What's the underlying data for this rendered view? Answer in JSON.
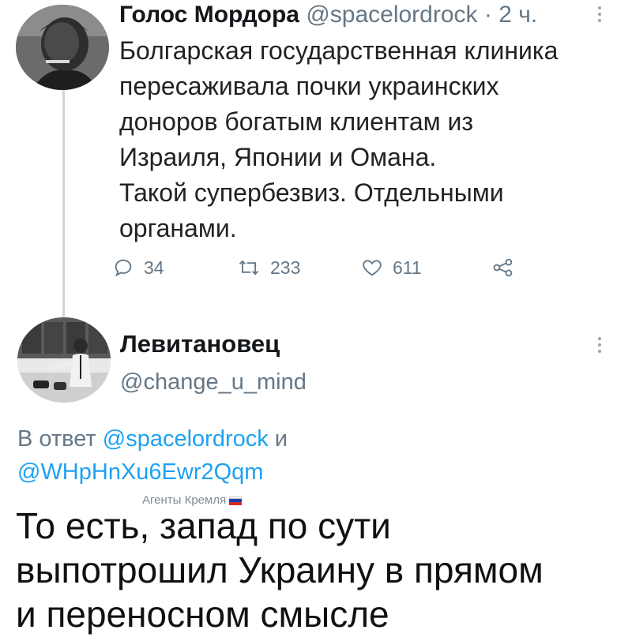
{
  "tweet1": {
    "name": "Голос Мордора",
    "handle": "@spacelordrock",
    "time": "· 2 ч.",
    "body_lines": [
      "Болгарская государственная клиника",
      "пересаживала почки украинских",
      "доноров богатым клиентам из",
      "Израиля, Японии и Омана.",
      "Такой супербезвиз. Отдельными",
      "органами."
    ],
    "actions": {
      "replies": "34",
      "retweets": "233",
      "likes": "611"
    }
  },
  "tweet2": {
    "name": "Левитановец",
    "handle": "@change_u_mind",
    "reply_prefix": "В ответ",
    "reply_to_1": "@spacelordrock",
    "reply_joiner": "и",
    "reply_to_2": "@WHpHnXu6Ewr2Qqm",
    "body_lines": [
      "То есть, запад по сути",
      "выпотрошил Украину в прямом",
      "и переносном смысле"
    ]
  },
  "watermark": "Агенты Кремля",
  "icons": {
    "reply": "reply-icon",
    "retweet": "retweet-icon",
    "like": "heart-icon",
    "share": "share-icon",
    "more": "more-vertical-icon",
    "flag": "russia-flag-icon"
  },
  "colors": {
    "link": "#1da1f2",
    "secondary_text": "#657786",
    "thread_line": "#cfd5da"
  }
}
